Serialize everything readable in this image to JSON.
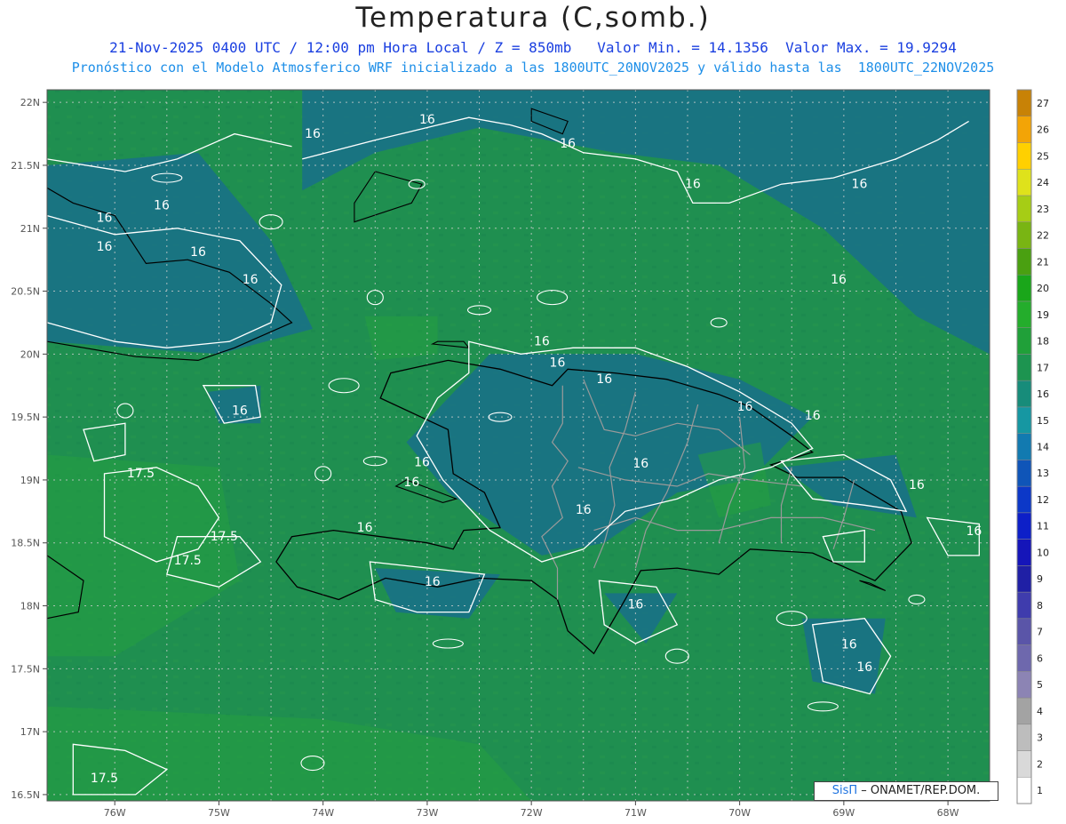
{
  "header": {
    "title": "Temperatura (C,somb.)",
    "line1": "21-Nov-2025 0400 UTC / 12:00 pm Hora Local / Z = 850mb   Valor Min. = 14.1356  Valor Max. = 19.9294",
    "line2": "Pronóstico con el Modelo Atmosferico WRF inicializado a las 1800UTC_20NOV2025 y válido hasta las  1800UTC_22NOV2025"
  },
  "credit": {
    "brand": "SisΠ",
    "org": "– ONAMET/REP.DOM."
  },
  "map": {
    "lon_range": [
      -76.65,
      -67.6
    ],
    "lat_range": [
      16.45,
      22.1
    ],
    "lat_labels": [
      "22N",
      "21.5N",
      "21N",
      "20.5N",
      "20N",
      "19.5N",
      "19N",
      "18.5N",
      "18N",
      "17.5N",
      "17N",
      "16.5N"
    ],
    "lon_labels": [
      "76W",
      "75W",
      "74W",
      "73W",
      "72W",
      "71W",
      "70W",
      "69W",
      "68W"
    ],
    "contour_labels": [
      {
        "text": "16",
        "lon": -73.0,
        "lat": 21.83
      },
      {
        "text": "16",
        "lon": -74.1,
        "lat": 21.72
      },
      {
        "text": "16",
        "lon": -71.65,
        "lat": 21.64
      },
      {
        "text": "16",
        "lon": -70.45,
        "lat": 21.32
      },
      {
        "text": "16",
        "lon": -68.85,
        "lat": 21.32
      },
      {
        "text": "16",
        "lon": -76.1,
        "lat": 21.05
      },
      {
        "text": "16",
        "lon": -75.55,
        "lat": 21.15
      },
      {
        "text": "16",
        "lon": -75.2,
        "lat": 20.78
      },
      {
        "text": "16",
        "lon": -76.1,
        "lat": 20.82
      },
      {
        "text": "16",
        "lon": -74.7,
        "lat": 20.56
      },
      {
        "text": "16",
        "lon": -69.05,
        "lat": 20.56
      },
      {
        "text": "16",
        "lon": -71.9,
        "lat": 20.07
      },
      {
        "text": "16",
        "lon": -71.75,
        "lat": 19.9
      },
      {
        "text": "16",
        "lon": -71.3,
        "lat": 19.77
      },
      {
        "text": "16",
        "lon": -74.8,
        "lat": 19.52
      },
      {
        "text": "16",
        "lon": -73.05,
        "lat": 19.11
      },
      {
        "text": "16",
        "lon": -70.95,
        "lat": 19.1
      },
      {
        "text": "16",
        "lon": -73.15,
        "lat": 18.95
      },
      {
        "text": "16",
        "lon": -69.3,
        "lat": 19.48
      },
      {
        "text": "16",
        "lon": -69.95,
        "lat": 19.55
      },
      {
        "text": "16",
        "lon": -68.3,
        "lat": 18.93
      },
      {
        "text": "16",
        "lon": -71.5,
        "lat": 18.73
      },
      {
        "text": "16",
        "lon": -73.6,
        "lat": 18.59
      },
      {
        "text": "16",
        "lon": -67.75,
        "lat": 18.56
      },
      {
        "text": "16",
        "lon": -72.95,
        "lat": 18.16
      },
      {
        "text": "16",
        "lon": -71.0,
        "lat": 17.98
      },
      {
        "text": "16",
        "lon": -68.95,
        "lat": 17.66
      },
      {
        "text": "16",
        "lon": -68.8,
        "lat": 17.48
      },
      {
        "text": "17.5",
        "lon": -75.75,
        "lat": 19.02
      },
      {
        "text": "17.5",
        "lon": -74.95,
        "lat": 18.52
      },
      {
        "text": "17.5",
        "lon": -75.3,
        "lat": 18.33
      },
      {
        "text": "17.5",
        "lon": -76.1,
        "lat": 16.6
      }
    ],
    "colors": {
      "sea": "#1f8f50",
      "cool": "#1a7f6a",
      "cooler": "#19708a",
      "warm": "#25a040",
      "coast": "#000000",
      "border": "#9a9a9a",
      "contour": "#ffffff",
      "grid": "#cfcfcf"
    }
  },
  "colorbar": {
    "labels": [
      "1",
      "2",
      "3",
      "4",
      "5",
      "6",
      "7",
      "8",
      "9",
      "10",
      "11",
      "12",
      "13",
      "14",
      "15",
      "16",
      "17",
      "18",
      "19",
      "20",
      "21",
      "22",
      "23",
      "24",
      "25",
      "26",
      "27"
    ],
    "colors": [
      "#ffffff",
      "#d9d9d9",
      "#bdbdbd",
      "#a3a3a3",
      "#8c84b4",
      "#6e68ad",
      "#5a55a8",
      "#3f3cad",
      "#1f1fa5",
      "#1515b9",
      "#0d1fc8",
      "#0c38c8",
      "#0f55b8",
      "#127ab0",
      "#1697a2",
      "#178c7a",
      "#1d9450",
      "#20a039",
      "#24ad2c",
      "#1aa61a",
      "#4aa011",
      "#79b513",
      "#a6cd15",
      "#dfe21b",
      "#ffd000",
      "#f3a406",
      "#c88206"
    ]
  }
}
